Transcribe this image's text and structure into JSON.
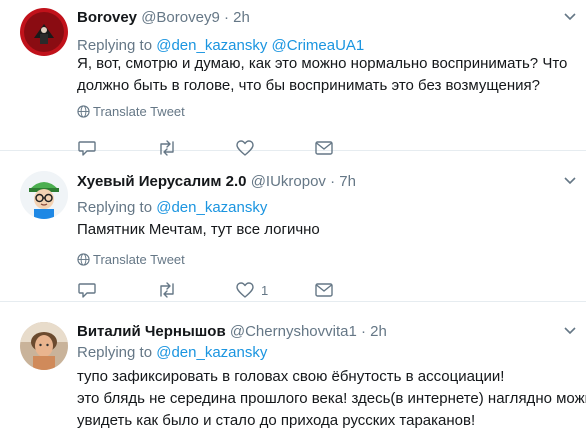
{
  "tweets": [
    {
      "name": "Borovey",
      "handle": "@Borovey9",
      "sep": "·",
      "time": "2h",
      "replying_prefix": "Replying to",
      "mentions": [
        "@den_kazansky",
        "@CrimeaUA1"
      ],
      "lines": [
        "Я, вот, смотрю и думаю, как это можно нормально воспринимать? Что",
        "должно быть в голове, что бы воспринимать это без возмущения?"
      ],
      "translate": "Translate Tweet",
      "like_count": ""
    },
    {
      "name": "Хуевый Иерусалим 2.0",
      "handle": "@IUkropov",
      "sep": "·",
      "time": "7h",
      "replying_prefix": "Replying to",
      "mentions": [
        "@den_kazansky"
      ],
      "lines": [
        "Памятник Мечтам,  тут все логично"
      ],
      "translate": "Translate Tweet",
      "like_count": "1"
    },
    {
      "name": "Виталий Чернышов",
      "handle": "@Chernyshovvita1",
      "sep": "·",
      "time": "2h",
      "replying_prefix": "Replying to",
      "mentions": [
        "@den_kazansky"
      ],
      "lines": [
        "тупо зафиксировать в головах свою ёбнутость в ассоциации!",
        "это блядь не середина прошлого века! здесь(в интернете) наглядно можно",
        "увидеть как было и стало до прихода русских тараканов!"
      ],
      "translate": "",
      "like_count": ""
    }
  ]
}
